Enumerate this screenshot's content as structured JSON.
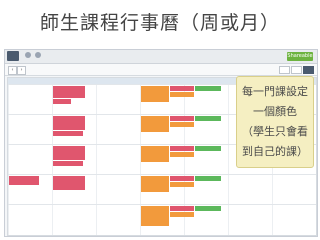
{
  "slide": {
    "title": "師生課程行事曆（周或月）"
  },
  "callout": {
    "lines": [
      "每一門課設定",
      "一個顏色",
      "（學生只會看",
      "到自己的課）"
    ]
  },
  "app": {
    "shareable_button": "Shareable"
  },
  "colors": {
    "red_event": "#e0566e",
    "orange_event": "#f29a3c",
    "green_event": "#5cb85c",
    "month_title": "#3b7dc4",
    "shareable_button": "#6db33f",
    "callout_bg": "#f5efc2"
  },
  "icons": [
    "calendar-logo-icon",
    "prev-arrow-icon",
    "next-arrow-icon",
    "search-icon",
    "settings-icon"
  ]
}
